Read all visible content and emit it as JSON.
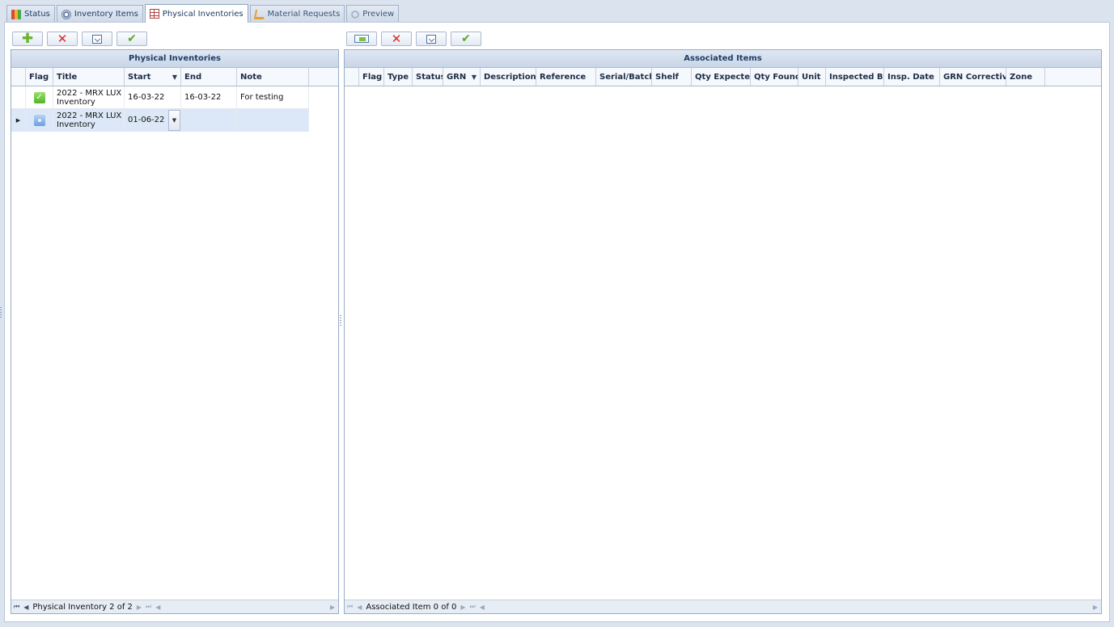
{
  "tabs": [
    {
      "label": "Status",
      "icon": "status-icon"
    },
    {
      "label": "Inventory Items",
      "icon": "gear-icon"
    },
    {
      "label": "Physical Inventories",
      "icon": "grid-icon"
    },
    {
      "label": "Material Requests",
      "icon": "cart-icon"
    },
    {
      "label": "Preview",
      "icon": "magnifier-icon"
    }
  ],
  "left_toolbar": {
    "add": "plus-icon",
    "delete": "delete-icon",
    "save": "save-icon",
    "confirm": "check-icon"
  },
  "right_toolbar": {
    "import": "import-icon",
    "delete": "delete-icon",
    "save": "save-icon",
    "confirm": "check-icon"
  },
  "physical_inventories": {
    "caption": "Physical Inventories",
    "columns": [
      "Flag",
      "Title",
      "Start",
      "End",
      "Note"
    ],
    "rows": [
      {
        "flag": "check-flag",
        "title": "2022 - MRX LUX Inventory",
        "start": "16-03-22",
        "end": "16-03-22",
        "note": "For testing"
      },
      {
        "flag": "blue-flag",
        "title": "2022 - MRX LUX Inventory",
        "start": "01-06-22",
        "end": "",
        "note": ""
      }
    ],
    "navigator_text": "Physical Inventory 2 of 2"
  },
  "associated_items": {
    "caption": "Associated Items",
    "columns": [
      "Flag",
      "Type",
      "Status",
      "GRN",
      "Description",
      "Reference",
      "Serial/Batch",
      "Shelf",
      "Qty Expected",
      "Qty Found",
      "Unit",
      "Inspected By",
      "Insp. Date",
      "GRN Corrective",
      "Zone"
    ],
    "navigator_text": "Associated Item 0 of 0"
  },
  "colors": {
    "tab_bg": "#dbe3ef",
    "caption_bg": "#c9d6e7",
    "selected_row": "#dce8f7"
  }
}
